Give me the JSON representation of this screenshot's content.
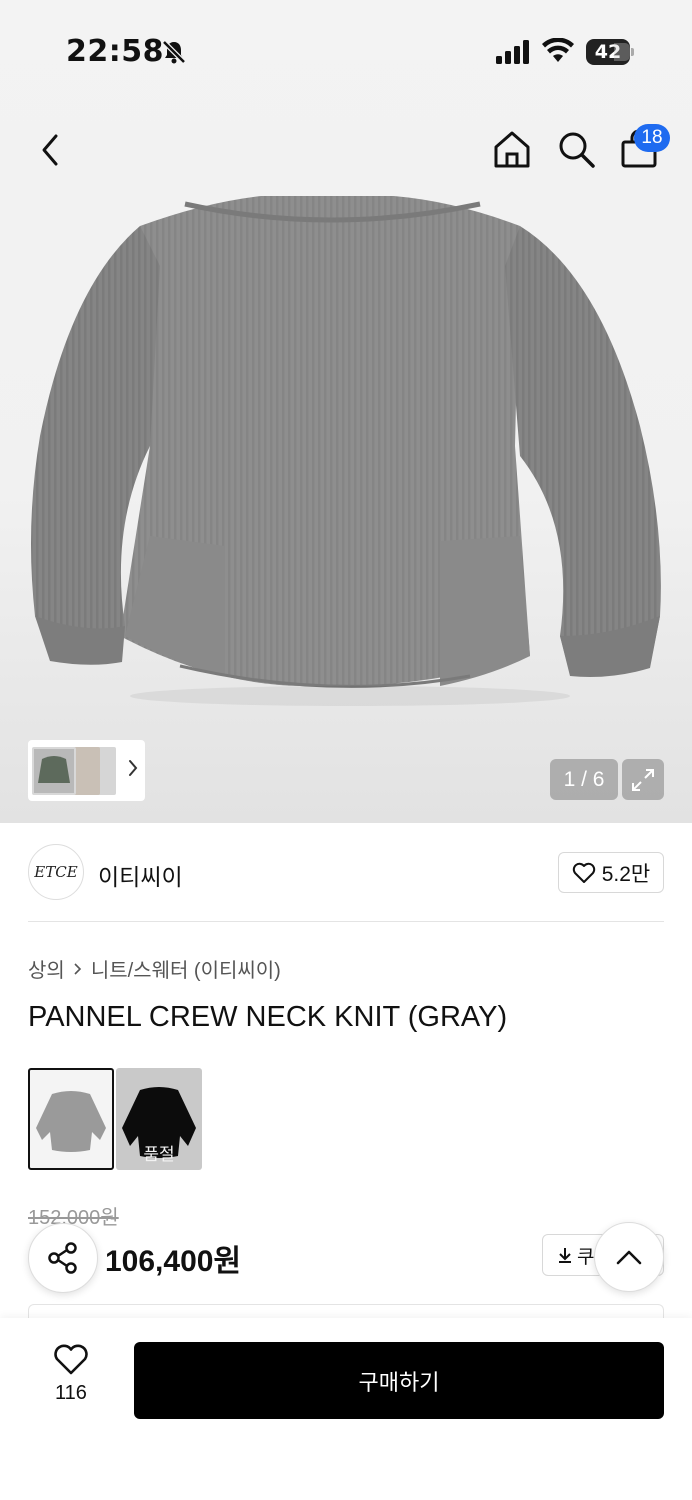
{
  "status_bar": {
    "time": "22:58",
    "battery": "42"
  },
  "header": {
    "cart_count": "18"
  },
  "gallery": {
    "counter": "1 / 6"
  },
  "brand": {
    "logo_text": "ETCE",
    "name": "이티씨이",
    "likes": "5.2만"
  },
  "breadcrumb": {
    "category": "상의",
    "subcategory": "니트/스웨터 (이티씨이)"
  },
  "product": {
    "title": "PANNEL CREW NECK KNIT (GRAY)",
    "color_options": [
      {
        "name": "gray",
        "selected": true,
        "label": ""
      },
      {
        "name": "black",
        "selected": false,
        "label": "품절"
      }
    ],
    "original_price": "152,000원",
    "sale_price": "106,400원",
    "coupon_label": "쿠폰"
  },
  "bottom_bar": {
    "wish_count": "116",
    "buy_label": "구매하기"
  },
  "colors": {
    "accent_blue": "#1f6bf0",
    "buy_button": "#000000",
    "knit_gray": "#8f8f8f"
  }
}
